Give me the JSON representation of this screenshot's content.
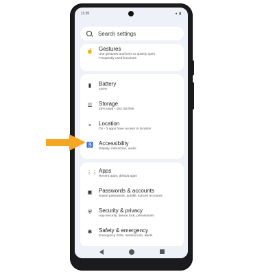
{
  "colors": {
    "arrow": "#f5a623",
    "screen_bg": "#eef1f7",
    "card_bg": "#ffffff",
    "phone_frame": "#1b1b1d"
  },
  "status": {
    "time": "11:35",
    "icons": "◂ ▮"
  },
  "search": {
    "placeholder": "Search settings"
  },
  "items": [
    {
      "icon": "gestures-icon",
      "glyph": "☝",
      "title": "Gestures",
      "sub1": "Use gestures and keys to quickly open",
      "sub2": "Frequently used functions"
    },
    {
      "icon": "battery-icon",
      "glyph": "▮",
      "title": "Battery",
      "sub1": "100%"
    },
    {
      "icon": "storage-icon",
      "glyph": "☰",
      "title": "Storage",
      "sub1": "25% used - 103 GB free"
    },
    {
      "icon": "location-icon",
      "glyph": "⌖",
      "title": "Location",
      "sub1": "On - 3 apps have access to location"
    },
    {
      "icon": "accessibility-icon",
      "glyph": "♿",
      "title": "Accessibility",
      "sub1": "Display, interaction, audio"
    },
    {
      "icon": "apps-icon",
      "glyph": "⋮⋮",
      "title": "Apps",
      "sub1": "Recent apps, default apps"
    },
    {
      "icon": "passwords-icon",
      "glyph": "▣",
      "title": "Passwords & accounts",
      "sub1": "Saved passwords, autofill, synced accounts"
    },
    {
      "icon": "security-icon",
      "glyph": "⛨",
      "title": "Security & privacy",
      "sub1": "App security, device lock, permissions"
    },
    {
      "icon": "emergency-icon",
      "glyph": "✱",
      "title": "Safety & emergency",
      "sub1": "Emergency SOS, medical info, alerts"
    }
  ]
}
